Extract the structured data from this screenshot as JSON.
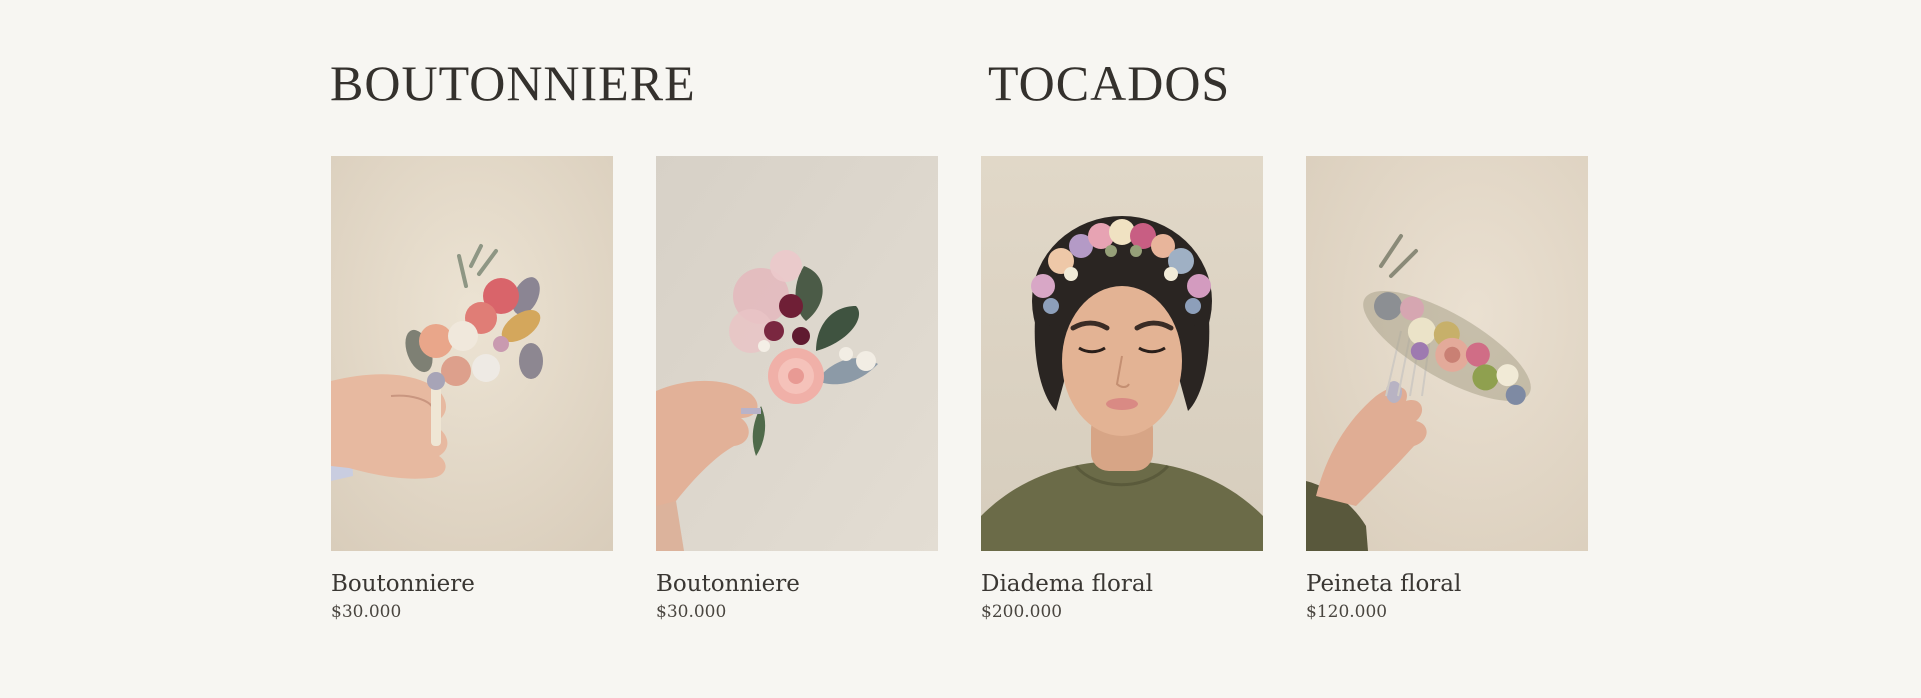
{
  "sections": [
    {
      "title": "BOUTONNIERE"
    },
    {
      "title": "TOCADOS"
    }
  ],
  "products": [
    {
      "name": "Boutonniere",
      "price": "$30.000",
      "image_icon": "boutonniere-photo"
    },
    {
      "name": "Boutonniere",
      "price": "$30.000",
      "image_icon": "boutonniere-rose-photo"
    },
    {
      "name": "Diadema floral",
      "price": "$200.000",
      "image_icon": "flower-crown-photo"
    },
    {
      "name": "Peineta floral",
      "price": "$120.000",
      "image_icon": "floral-comb-photo"
    }
  ],
  "colors": {
    "background": "#f7f6f2",
    "text": "#3a3733",
    "photo_wall": "#e2d9ca"
  }
}
